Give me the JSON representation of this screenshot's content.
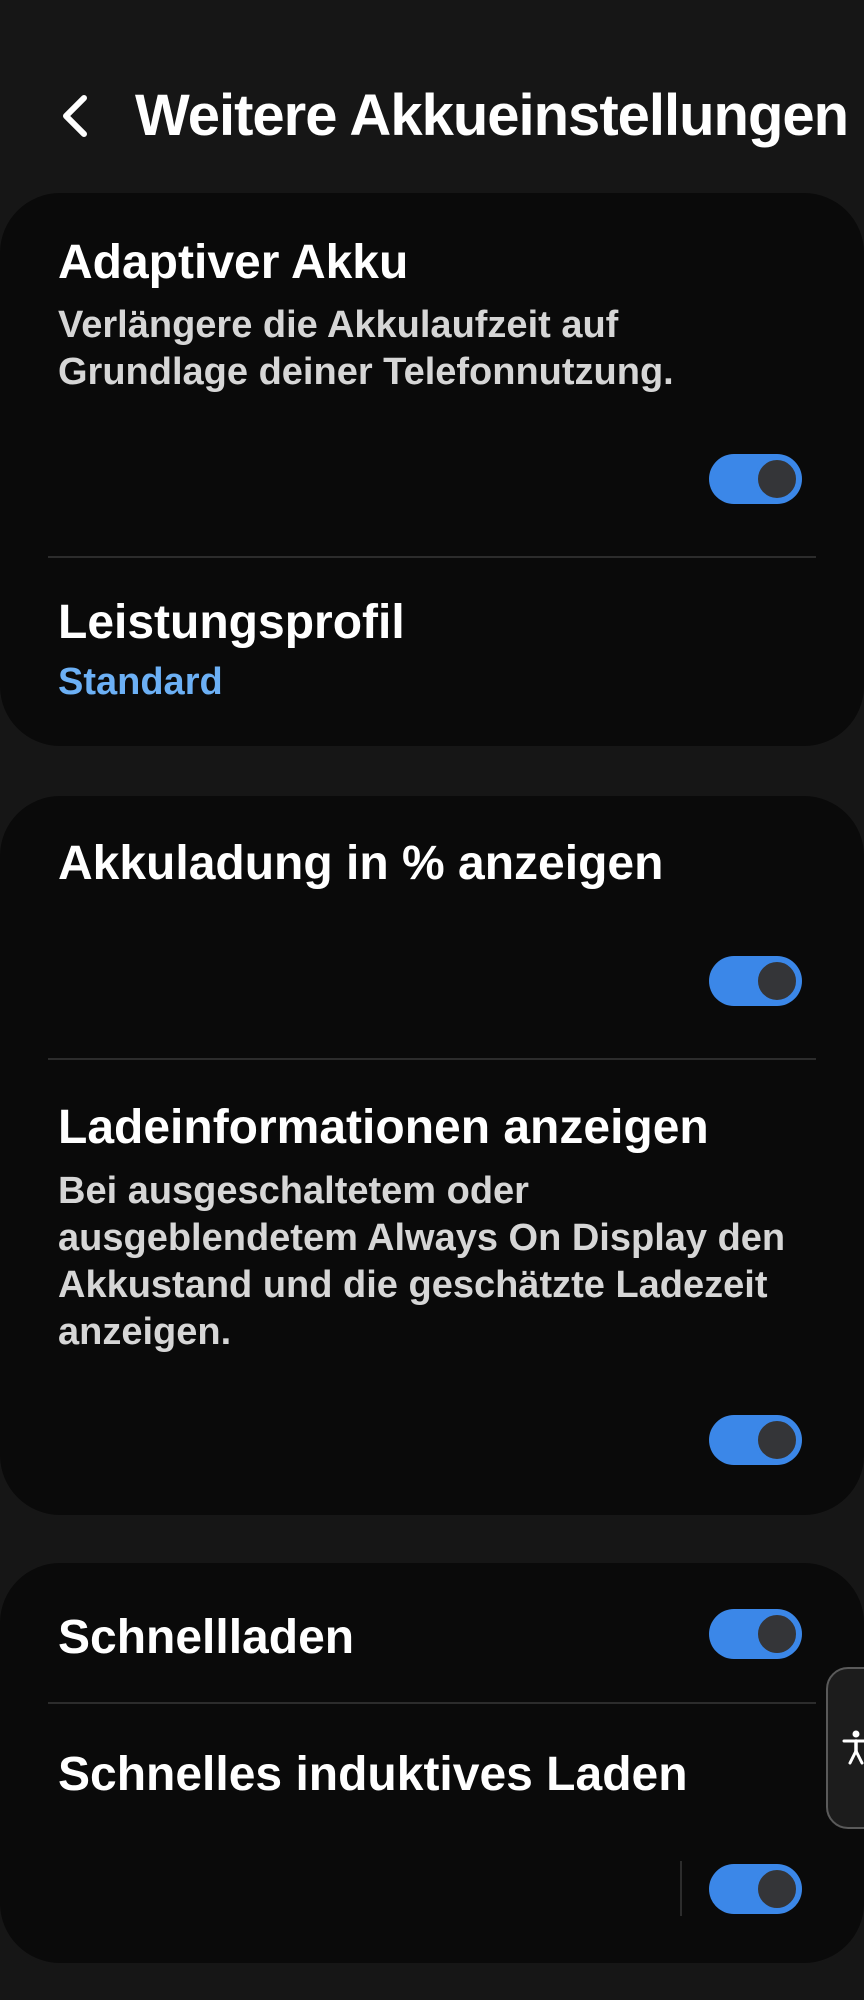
{
  "header": {
    "title": "Weitere Akkueinstellungen",
    "back_icon": "chevron-left-icon"
  },
  "card1": {
    "adaptive_battery": {
      "title": "Adaptiver Akku",
      "description": "Verlängere die Akkulaufzeit auf Grundlage deiner Telefonnutzung.",
      "enabled": true
    },
    "performance_profile": {
      "title": "Leistungsprofil",
      "value": "Standard"
    }
  },
  "card2": {
    "battery_percentage": {
      "title": "Akkuladung in % anzeigen",
      "enabled": true
    },
    "charging_info": {
      "title": "Ladeinformationen anzeigen",
      "description": "Bei ausgeschaltetem oder ausgeblendetem Always On Display den Akkustand und die geschätzte Ladezeit anzeigen.",
      "enabled": true
    }
  },
  "card3": {
    "fast_charging": {
      "title": "Schnellladen",
      "enabled": true
    },
    "fast_wireless_charging": {
      "title": "Schnelles induktives Laden",
      "enabled": true
    }
  },
  "accessibility_tab": {
    "icon": "accessibility-person-icon"
  },
  "colors": {
    "background": "#161616",
    "card": "#0a0a0a",
    "accent": "#3b87e8",
    "link": "#6cb0f5",
    "description": "#d6d6d6"
  }
}
